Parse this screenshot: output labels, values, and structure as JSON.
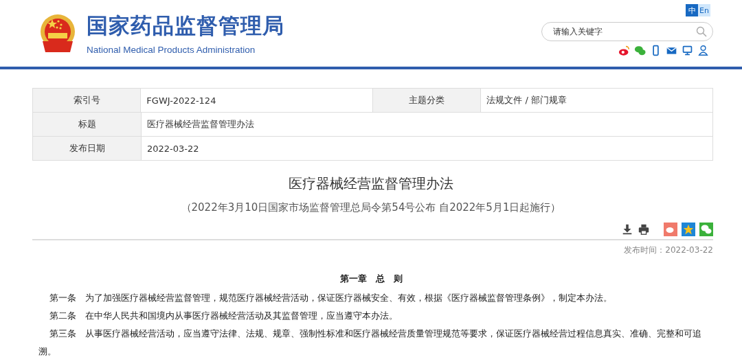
{
  "header": {
    "title": "国家药品监督管理局",
    "subtitle": "National Medical Products Administration",
    "languages": [
      {
        "label": "中",
        "selected": true
      },
      {
        "label": "En",
        "selected": false
      }
    ],
    "search": {
      "placeholder": "请输入关键字"
    }
  },
  "info_table": {
    "rows": [
      {
        "cells": [
          {
            "label": "索引号",
            "value": "FGWJ-2022-124"
          },
          {
            "label": "主题分类",
            "value": "法规文件 / 部门规章"
          }
        ]
      },
      {
        "cells": [
          {
            "label": "标题",
            "value": "医疗器械经营监督管理办法"
          }
        ]
      },
      {
        "cells": [
          {
            "label": "发布日期",
            "value": "2022-03-22"
          }
        ]
      }
    ]
  },
  "article": {
    "title": "医疗器械经营监督管理办法",
    "subtitle": "（2022年3月10日国家市场监督管理总局令第54号公布 自2022年5月1日起施行）",
    "publish_label": "发布时间：",
    "publish_date": "2022-03-22",
    "chapter": "第一章　总　则",
    "paragraphs": [
      "第一条　为了加强医疗器械经营监督管理，规范医疗器械经营活动，保证医疗器械安全、有效，根据《医疗器械监督管理条例》，制定本办法。",
      "第二条　在中华人民共和国境内从事医疗器械经营活动及其监督管理，应当遵守本办法。",
      "第三条　从事医疗器械经营活动，应当遵守法律、法规、规章、强制性标准和医疗器械经营质量管理规范等要求，保证医疗器械经营过程信息真实、准确、完整和可追溯。"
    ]
  }
}
